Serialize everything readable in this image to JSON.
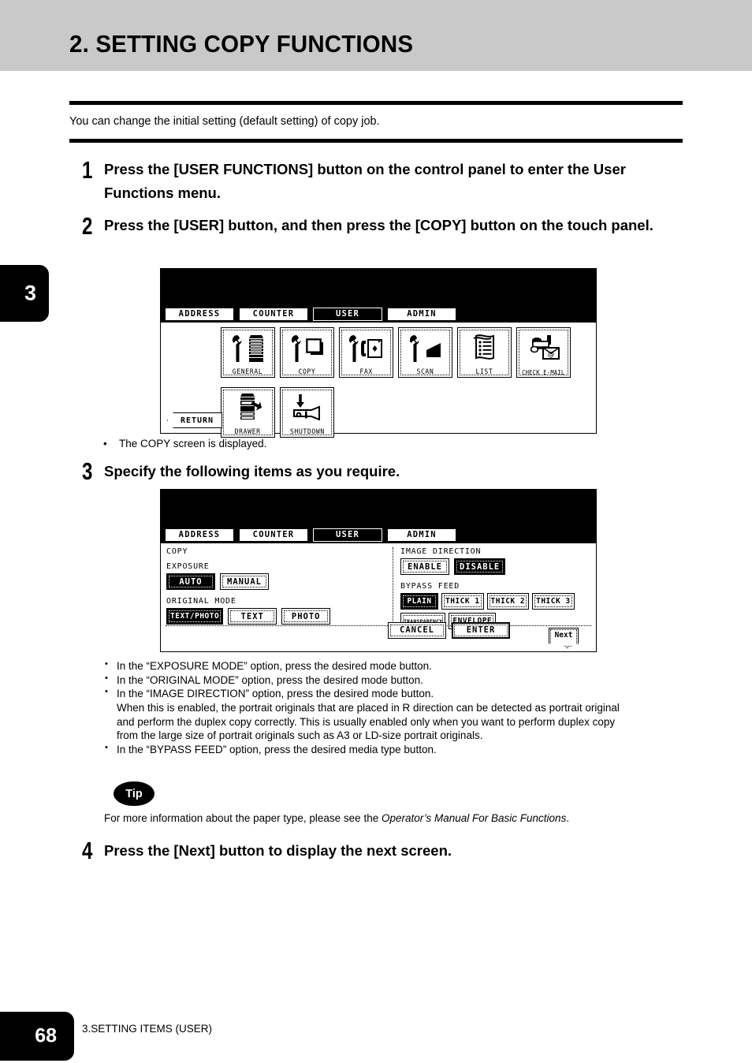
{
  "header": {
    "chapter_title": "2. SETTING COPY FUNCTIONS",
    "chapter_tab_number": "3"
  },
  "intro": {
    "text": "You can change the initial setting (default setting) of copy job."
  },
  "steps": [
    {
      "number": "1",
      "text": "Press the [USER FUNCTIONS] button on the control panel to enter the User Functions menu."
    },
    {
      "number": "2",
      "text": "Press the [USER] button, and then press the [COPY] button on the touch panel."
    },
    {
      "number": "3",
      "text": "Specify the following items as you require."
    },
    {
      "number": "4",
      "text": "Press the [Next] button to display the next screen."
    }
  ],
  "note_after_step2": "The COPY screen is displayed.",
  "panel_user_menu": {
    "tabs": [
      {
        "label": "ADDRESS",
        "selected": false
      },
      {
        "label": "COUNTER",
        "selected": false
      },
      {
        "label": "USER",
        "selected": true
      },
      {
        "label": "ADMIN",
        "selected": false
      }
    ],
    "icons": [
      {
        "label": "GENERAL",
        "icon": "wrench-copier-icon"
      },
      {
        "label": "COPY",
        "icon": "wrench-pages-icon"
      },
      {
        "label": "FAX",
        "icon": "wrench-fax-icon"
      },
      {
        "label": "SCAN",
        "icon": "wrench-scanner-icon"
      },
      {
        "label": "LIST",
        "icon": "list-pages-icon"
      },
      {
        "label": "CHECK E-MAIL",
        "icon": "mailbox-email-icon"
      },
      {
        "label": "DRAWER",
        "icon": "copier-drawer-icon"
      },
      {
        "label": "SHUTDOWN",
        "icon": "shutdown-icon"
      }
    ],
    "return_label": "RETURN"
  },
  "panel_copy_settings": {
    "tabs": [
      {
        "label": "ADDRESS",
        "selected": false
      },
      {
        "label": "COUNTER",
        "selected": false
      },
      {
        "label": "USER",
        "selected": true
      },
      {
        "label": "ADMIN",
        "selected": false
      }
    ],
    "screen_title": "COPY",
    "groups": [
      {
        "label": "EXPOSURE",
        "options": [
          {
            "label": "AUTO",
            "selected": true
          },
          {
            "label": "MANUAL",
            "selected": false
          }
        ]
      },
      {
        "label": "ORIGINAL MODE",
        "options": [
          {
            "label": "TEXT/PHOTO",
            "selected": true
          },
          {
            "label": "TEXT",
            "selected": false
          },
          {
            "label": "PHOTO",
            "selected": false
          }
        ]
      },
      {
        "label": "IMAGE DIRECTION",
        "options": [
          {
            "label": "ENABLE",
            "selected": false
          },
          {
            "label": "DISABLE",
            "selected": true
          }
        ]
      },
      {
        "label": "BYPASS FEED",
        "options": [
          {
            "label": "PLAIN",
            "selected": true
          },
          {
            "label": "THICK 1",
            "selected": false
          },
          {
            "label": "THICK 2",
            "selected": false
          },
          {
            "label": "THICK 3",
            "selected": false
          },
          {
            "label": "TRANSPARENCY",
            "selected": false
          },
          {
            "label": "ENVELOPE",
            "selected": false
          }
        ]
      }
    ],
    "cancel_label": "CANCEL",
    "enter_label": "ENTER",
    "next_label": "Next"
  },
  "bullets_after_step3": [
    {
      "text": "In the “EXPOSURE MODE” option, press the desired mode button.",
      "continuation": []
    },
    {
      "text": "In the “ORIGINAL MODE” option, press the desired mode button.",
      "continuation": []
    },
    {
      "text": "In the “IMAGE DIRECTION” option, press the desired mode button.",
      "continuation": [
        "When this is enabled, the portrait originals that are placed in R direction can be detected as portrait original",
        "and perform the duplex copy correctly.  This is usually enabled only when you want to perform duplex copy",
        "from the large size of portrait originals such as A3 or LD-size portrait originals."
      ]
    },
    {
      "text": "In the “BYPASS FEED” option, press the desired media type button.",
      "continuation": []
    }
  ],
  "tip": {
    "badge": "Tip",
    "text_before": "For more information about the paper type, please see the ",
    "text_italic": "Operator’s Manual For Basic Functions",
    "text_after": "."
  },
  "footer": {
    "page_number": "68",
    "section": "3.SETTING ITEMS (USER)"
  },
  "colors": {
    "header_band": "#c9c9c9",
    "text": "#000000",
    "page_background": "#ffffff"
  }
}
